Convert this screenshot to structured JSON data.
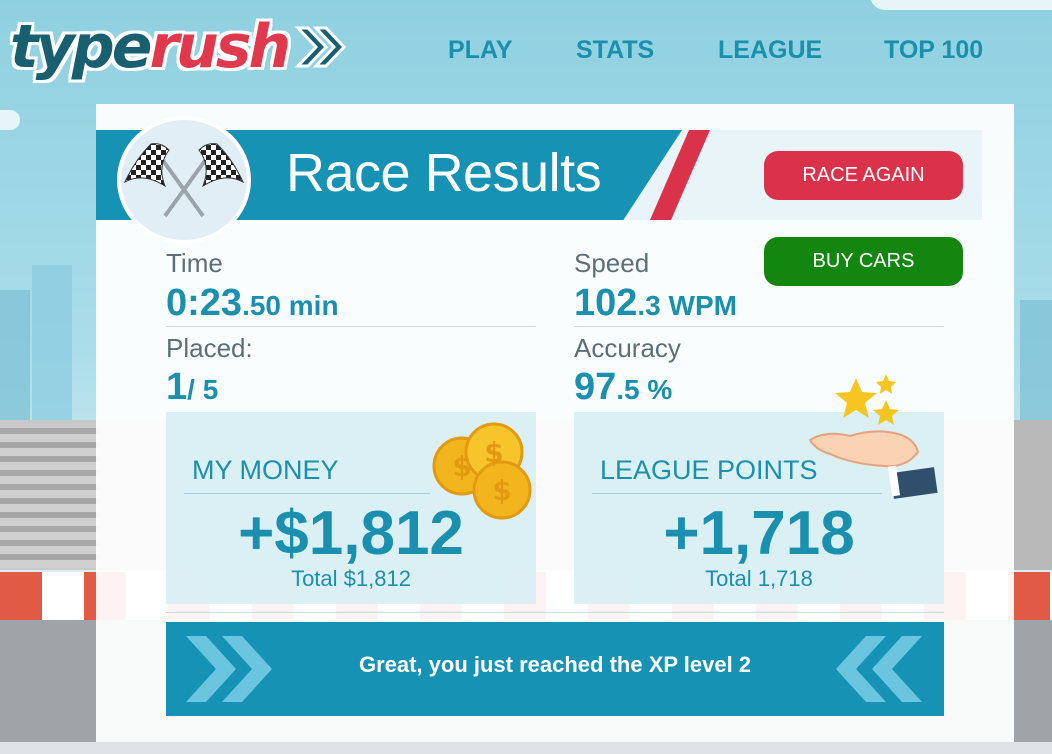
{
  "brand": {
    "part1": "type",
    "part2": "rush"
  },
  "nav": {
    "play": "PLAY",
    "stats": "STATS",
    "league": "LEAGUE",
    "top100": "TOP 100"
  },
  "results": {
    "title": "Race Results",
    "race_again": "RACE AGAIN",
    "buy_cars": "BUY CARS",
    "time": {
      "label": "Time",
      "value_big": "0:23",
      "value_small": ".50 min"
    },
    "speed": {
      "label": "Speed",
      "value_big": "102",
      "value_small": ".3 WPM"
    },
    "placed": {
      "label": "Placed:",
      "value_big": "1",
      "value_small": "/ 5"
    },
    "accuracy": {
      "label": "Accuracy",
      "value_big": "97",
      "value_small": ".5 %"
    }
  },
  "money": {
    "title": "MY MONEY",
    "amount": "+$1,812",
    "total": "Total $1,812"
  },
  "league_points": {
    "title": "LEAGUE POINTS",
    "amount": "+1,718",
    "total": "Total 1,718"
  },
  "xp_message": "Great, you just reached the XP level 2",
  "colors": {
    "accent": "#1592b4",
    "race_again": "#d9324a",
    "buy_cars": "#12860e",
    "text_blue": "#1a8fae"
  },
  "icons": [
    "checkered-flags-icon",
    "coins-icon",
    "hand-stars-icon",
    "double-chevron-right-icon",
    "double-chevron-left-icon"
  ]
}
